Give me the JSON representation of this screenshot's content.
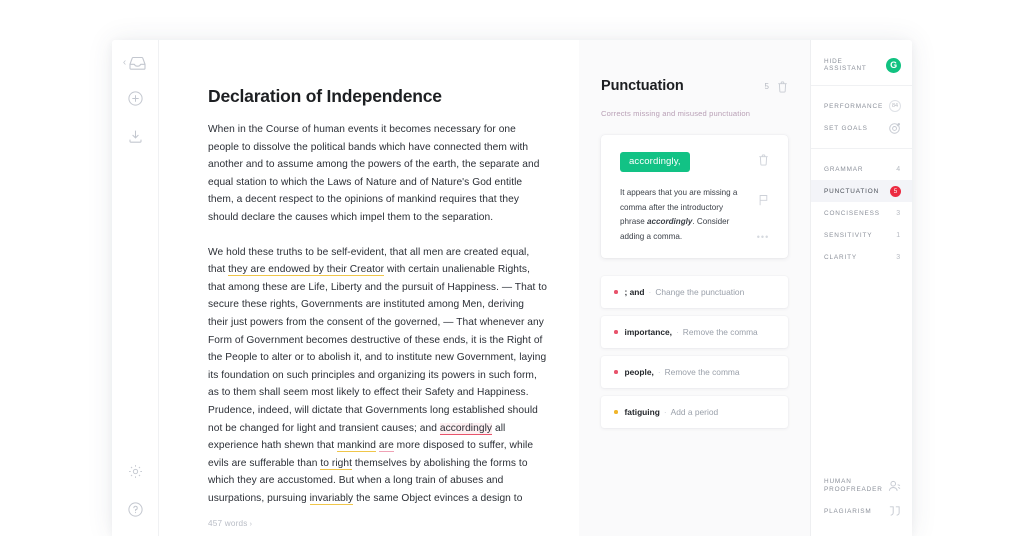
{
  "left_rail": {
    "icons": [
      {
        "name": "inbox-icon",
        "glyph": "inbox"
      },
      {
        "name": "add-new-icon",
        "glyph": "plus-circle"
      },
      {
        "name": "download-icon",
        "glyph": "download"
      }
    ],
    "bottom_icons": [
      {
        "name": "settings-gear-icon",
        "glyph": "gear"
      },
      {
        "name": "help-icon",
        "glyph": "question-circle"
      }
    ]
  },
  "document": {
    "title": "Declaration of Independence",
    "word_count": "457 words",
    "word_count_chevron": "›",
    "paragraphs": [
      {
        "id": "p1",
        "segments": [
          {
            "text": "When in the Course of human events it becomes necessary for one people to dissolve the political bands which have connected them with another and to assume among the powers of the earth, the separate and equal station to which the Laws of Nature and of Nature's God entitle them, a decent respect to the opinions of mankind requires that they should declare the causes which impel them to the separation.",
            "mark": "none"
          }
        ]
      },
      {
        "id": "p2",
        "segments": [
          {
            "text": "We hold these truths to be self-evident, that all men are created equal, that ",
            "mark": "none"
          },
          {
            "text": "they are endowed by their Creator",
            "mark": "yellow"
          },
          {
            "text": " with certain unalienable Rights, that among these are Life, Liberty and the pursuit of Happiness. — That to secure these rights, Governments are instituted among Men, deriving their just powers from the consent of the governed, — That whenever any Form of Government becomes destructive of these ends, it is the Right of the People to alter or to abolish it, and to institute new Government, laying its foundation on such principles and organizing its powers in such form, as to them shall seem most likely to effect their Safety and Happiness. Prudence, indeed, will dictate that Governments long established should not be changed for light and transient causes; and ",
            "mark": "none"
          },
          {
            "text": "accordingly",
            "mark": "red"
          },
          {
            "text": " all experience hath shewn that ",
            "mark": "none"
          },
          {
            "text": "mankind",
            "mark": "yellow"
          },
          {
            "text": " ",
            "mark": "none"
          },
          {
            "text": "are",
            "mark": "pink"
          },
          {
            "text": " more disposed to suffer, while evils are sufferable than ",
            "mark": "none"
          },
          {
            "text": "to right",
            "mark": "yellow"
          },
          {
            "text": " themselves by abolishing the forms to which they are accustomed. But when a long train of abuses and usurpations, pursuing ",
            "mark": "none"
          },
          {
            "text": "invariably",
            "mark": "yellow"
          },
          {
            "text": " the same Object evinces a design to",
            "mark": "none"
          }
        ]
      }
    ]
  },
  "suggestions": {
    "title": "Punctuation",
    "count": "5",
    "subtitle": "Corrects missing and misused punctuation",
    "delete_icon": "trash-icon",
    "card": {
      "chip": "accordingly,",
      "chip_color": "#12c285",
      "explanation_before": "It appears that you are missing a comma after the introductory phrase ",
      "explanation_term": "accordingly",
      "explanation_after": ". Consider adding a comma.",
      "actions": [
        "trash-icon",
        "flag-icon",
        "more-icon"
      ],
      "more_glyph": "•••"
    },
    "items": [
      {
        "word": "; and",
        "dash": "·",
        "action": "Change the punctuation",
        "bullet_color": "#e8536b"
      },
      {
        "word": "importance,",
        "dash": "·",
        "action": "Remove the comma",
        "bullet_color": "#e8536b"
      },
      {
        "word": "people,",
        "dash": "·",
        "action": "Remove the comma",
        "bullet_color": "#e8536b"
      },
      {
        "word": "fatiguing",
        "dash": "·",
        "action": "Add a period",
        "bullet_color": "#f0b429"
      }
    ]
  },
  "assistant": {
    "hide_label": "Hide Assistant",
    "logo_letter": "G",
    "logo_color": "#11c281",
    "performance_label": "Performance",
    "performance_score": "84",
    "set_goals_label": "Set Goals",
    "categories": [
      {
        "label": "Grammar",
        "count": "4",
        "active": false
      },
      {
        "label": "Punctuation",
        "count": "5",
        "active": true
      },
      {
        "label": "Conciseness",
        "count": "3",
        "active": false
      },
      {
        "label": "Sensitivity",
        "count": "1",
        "active": false
      },
      {
        "label": "Clarity",
        "count": "3",
        "active": false
      }
    ],
    "active_badge_color": "#ec2b41",
    "human_proofreader_label": "Human Proofreader",
    "plagiarism_label": "Plagiarism",
    "plagiarism_glyph": "””"
  }
}
